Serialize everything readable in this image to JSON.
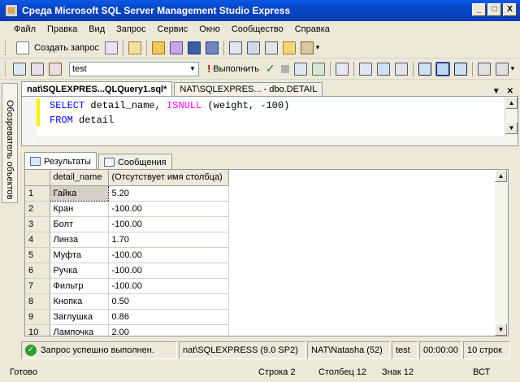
{
  "window": {
    "title": "Среда Microsoft SQL Server Management Studio Express",
    "min": "_",
    "max": "□",
    "close": "X"
  },
  "menu": [
    "Файл",
    "Правка",
    "Вид",
    "Запрос",
    "Сервис",
    "Окно",
    "Сообщество",
    "Справка"
  ],
  "toolbar1": {
    "new_query": "Создать запрос"
  },
  "toolbar2": {
    "database": "test",
    "execute": "Выполнить"
  },
  "sidebar": {
    "object_explorer": "Обозреватель объектов"
  },
  "doc_tabs": [
    {
      "label": "nat\\SQLEXPRES...QLQuery1.sql*"
    },
    {
      "label": "NAT\\SQLEXPRES... - dbo.DETAIL"
    }
  ],
  "editor": {
    "line1": {
      "kw": "SELECT",
      "a": " detail_name, ",
      "fn": "ISNULL",
      "b": " (weight, -100)"
    },
    "line2": {
      "kw": "FROM",
      "a": " detail"
    }
  },
  "result_tabs": [
    "Результаты",
    "Сообщения"
  ],
  "grid": {
    "headers": [
      "detail_name",
      "(Отсутствует имя столбца)"
    ],
    "rows": [
      [
        "1",
        "Гайка",
        "5.20"
      ],
      [
        "2",
        "Кран",
        "-100.00"
      ],
      [
        "3",
        "Болт",
        "-100.00"
      ],
      [
        "4",
        "Линза",
        "1.70"
      ],
      [
        "5",
        "Муфта",
        "-100.00"
      ],
      [
        "6",
        "Ручка",
        "-100.00"
      ],
      [
        "7",
        "Фильтр",
        "-100.00"
      ],
      [
        "8",
        "Кнопка",
        "0.50"
      ],
      [
        "9",
        "Заглушка",
        "0.86"
      ],
      [
        "10",
        "Лампочка",
        "2.00"
      ]
    ]
  },
  "query_status": {
    "message": "Запрос успешно выполнен.",
    "server": "nat\\SQLEXPRESS (9.0 SP2)",
    "user": "NAT\\Natasha (52)",
    "db": "test",
    "time": "00:00:00",
    "rows": "10 строк"
  },
  "statusbar": {
    "ready": "Готово",
    "line": "Строка 2",
    "col": "Столбец 12",
    "ch": "Знак 12",
    "mode": "ВСТ"
  }
}
